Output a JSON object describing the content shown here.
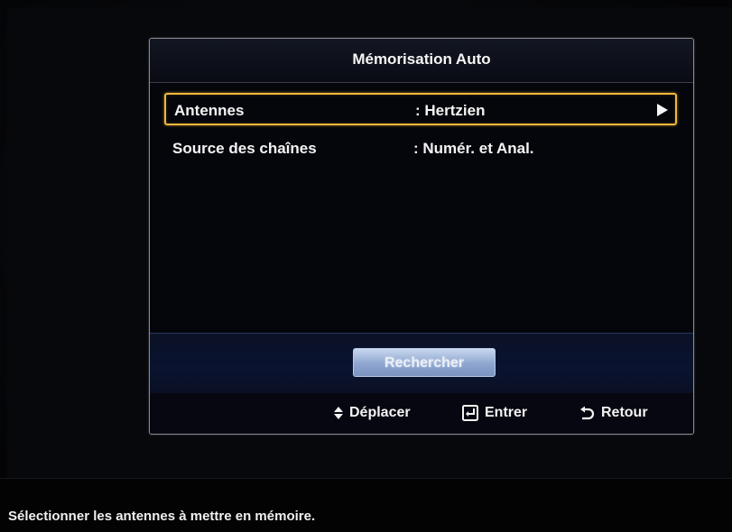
{
  "dialog": {
    "title": "Mémorisation Auto"
  },
  "settings": [
    {
      "label": "Antennes",
      "value": ": Hertzien",
      "selected": true,
      "icon": "arrow-right-icon"
    },
    {
      "label": "Source des chaînes",
      "value": ": Numér. et Anal.",
      "selected": false
    }
  ],
  "actions": {
    "search_label": "Rechercher"
  },
  "footer": {
    "move_label": "Déplacer",
    "move_icon": "up-down-icon",
    "enter_label": "Entrer",
    "enter_icon": "enter-icon",
    "return_label": "Retour",
    "return_icon": "return-icon"
  },
  "status": {
    "message": "Sélectionner les antennes à mettre en mémoire."
  },
  "colors": {
    "selection_border": "#f0b63a",
    "action_band": "#0a1330",
    "button_face": "#8ea6cf"
  }
}
